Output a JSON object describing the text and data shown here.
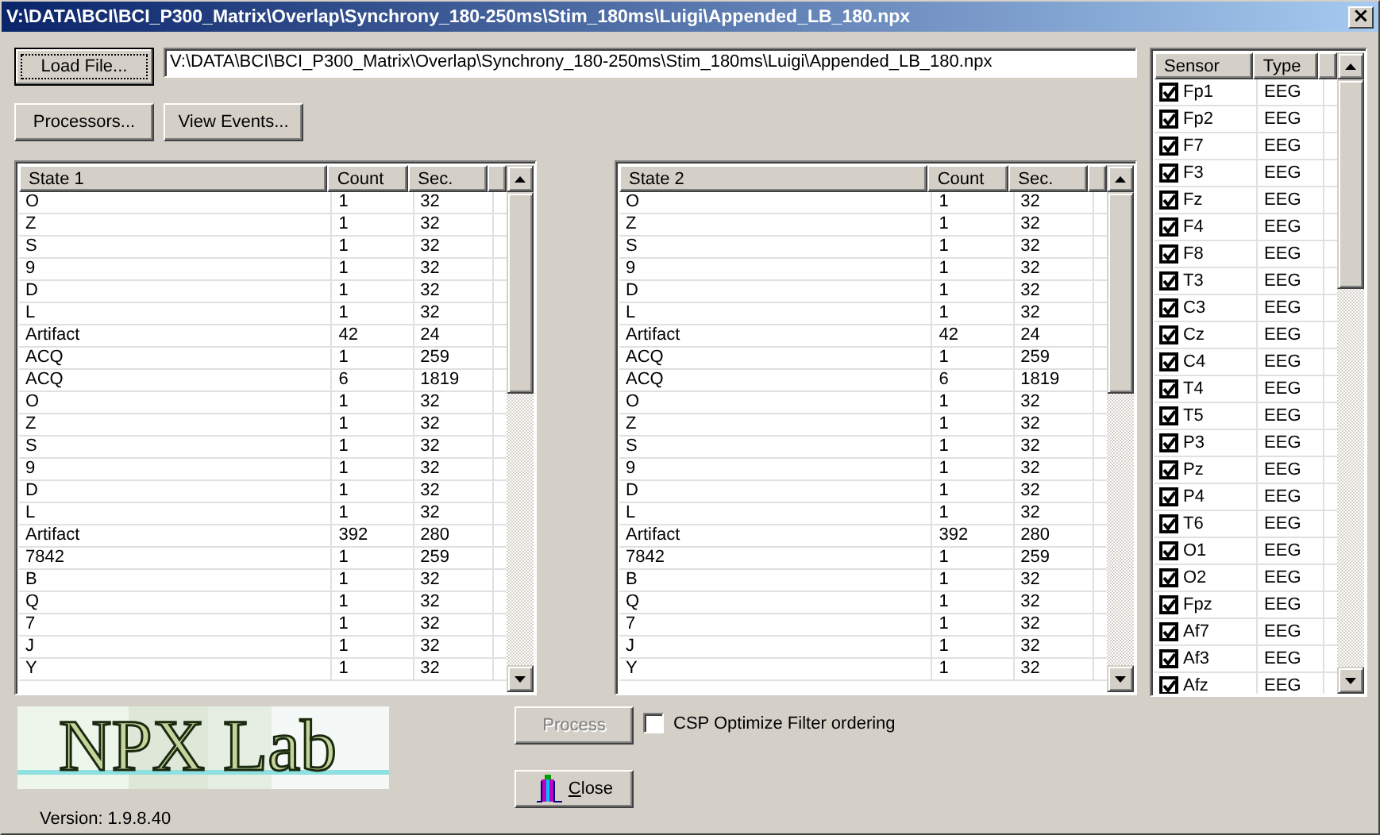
{
  "window": {
    "title": "V:\\DATA\\BCI\\BCI_P300_Matrix\\Overlap\\Synchrony_180-250ms\\Stim_180ms\\Luigi\\Appended_LB_180.npx",
    "close": "×"
  },
  "load_button": "Load File...",
  "file_path": "V:\\DATA\\BCI\\BCI_P300_Matrix\\Overlap\\Synchrony_180-250ms\\Stim_180ms\\Luigi\\Appended_LB_180.npx",
  "buttons": [
    "Processors...",
    "View Events..."
  ],
  "tables": [
    {
      "columns": [
        "State 1",
        "Count",
        "Sec."
      ],
      "rows": [
        [
          "O",
          "1",
          "32"
        ],
        [
          "Z",
          "1",
          "32"
        ],
        [
          "S",
          "1",
          "32"
        ],
        [
          "9",
          "1",
          "32"
        ],
        [
          "D",
          "1",
          "32"
        ],
        [
          "L",
          "1",
          "32"
        ],
        [
          "Artifact",
          "42",
          "24"
        ],
        [
          "ACQ",
          "1",
          "259"
        ],
        [
          "ACQ",
          "6",
          "1819"
        ],
        [
          "O",
          "1",
          "32"
        ],
        [
          "Z",
          "1",
          "32"
        ],
        [
          "S",
          "1",
          "32"
        ],
        [
          "9",
          "1",
          "32"
        ],
        [
          "D",
          "1",
          "32"
        ],
        [
          "L",
          "1",
          "32"
        ],
        [
          "Artifact",
          "392",
          "280"
        ],
        [
          "7842",
          "1",
          "259"
        ],
        [
          "B",
          "1",
          "32"
        ],
        [
          "Q",
          "1",
          "32"
        ],
        [
          "7",
          "1",
          "32"
        ],
        [
          "J",
          "1",
          "32"
        ],
        [
          "Y",
          "1",
          "32"
        ]
      ]
    },
    {
      "columns": [
        "State 2",
        "Count",
        "Sec."
      ],
      "rows": [
        [
          "O",
          "1",
          "32"
        ],
        [
          "Z",
          "1",
          "32"
        ],
        [
          "S",
          "1",
          "32"
        ],
        [
          "9",
          "1",
          "32"
        ],
        [
          "D",
          "1",
          "32"
        ],
        [
          "L",
          "1",
          "32"
        ],
        [
          "Artifact",
          "42",
          "24"
        ],
        [
          "ACQ",
          "1",
          "259"
        ],
        [
          "ACQ",
          "6",
          "1819"
        ],
        [
          "O",
          "1",
          "32"
        ],
        [
          "Z",
          "1",
          "32"
        ],
        [
          "S",
          "1",
          "32"
        ],
        [
          "9",
          "1",
          "32"
        ],
        [
          "D",
          "1",
          "32"
        ],
        [
          "L",
          "1",
          "32"
        ],
        [
          "Artifact",
          "392",
          "280"
        ],
        [
          "7842",
          "1",
          "259"
        ],
        [
          "B",
          "1",
          "32"
        ],
        [
          "Q",
          "1",
          "32"
        ],
        [
          "7",
          "1",
          "32"
        ],
        [
          "J",
          "1",
          "32"
        ],
        [
          "Y",
          "1",
          "32"
        ]
      ]
    }
  ],
  "sensors": {
    "columns": [
      "Sensor",
      "Type"
    ],
    "rows": [
      {
        "name": "Fp1",
        "type": "EEG",
        "checked": true
      },
      {
        "name": "Fp2",
        "type": "EEG",
        "checked": true
      },
      {
        "name": "F7",
        "type": "EEG",
        "checked": true
      },
      {
        "name": "F3",
        "type": "EEG",
        "checked": true
      },
      {
        "name": "Fz",
        "type": "EEG",
        "checked": true
      },
      {
        "name": "F4",
        "type": "EEG",
        "checked": true
      },
      {
        "name": "F8",
        "type": "EEG",
        "checked": true
      },
      {
        "name": "T3",
        "type": "EEG",
        "checked": true
      },
      {
        "name": "C3",
        "type": "EEG",
        "checked": true
      },
      {
        "name": "Cz",
        "type": "EEG",
        "checked": true
      },
      {
        "name": "C4",
        "type": "EEG",
        "checked": true
      },
      {
        "name": "T4",
        "type": "EEG",
        "checked": true
      },
      {
        "name": "T5",
        "type": "EEG",
        "checked": true
      },
      {
        "name": "P3",
        "type": "EEG",
        "checked": true
      },
      {
        "name": "Pz",
        "type": "EEG",
        "checked": true
      },
      {
        "name": "P4",
        "type": "EEG",
        "checked": true
      },
      {
        "name": "T6",
        "type": "EEG",
        "checked": true
      },
      {
        "name": "O1",
        "type": "EEG",
        "checked": true
      },
      {
        "name": "O2",
        "type": "EEG",
        "checked": true
      },
      {
        "name": "Fpz",
        "type": "EEG",
        "checked": true
      },
      {
        "name": "Af7",
        "type": "EEG",
        "checked": true
      },
      {
        "name": "Af3",
        "type": "EEG",
        "checked": true
      },
      {
        "name": "Afz",
        "type": "EEG",
        "checked": true
      }
    ]
  },
  "logo": "NPX Lab",
  "version": "Version: 1.9.8.40",
  "process_button": {
    "label": "Process",
    "disabled": true
  },
  "csp_option": {
    "label": "CSP Optimize Filter ordering",
    "checked": false
  },
  "close_button": "Close"
}
